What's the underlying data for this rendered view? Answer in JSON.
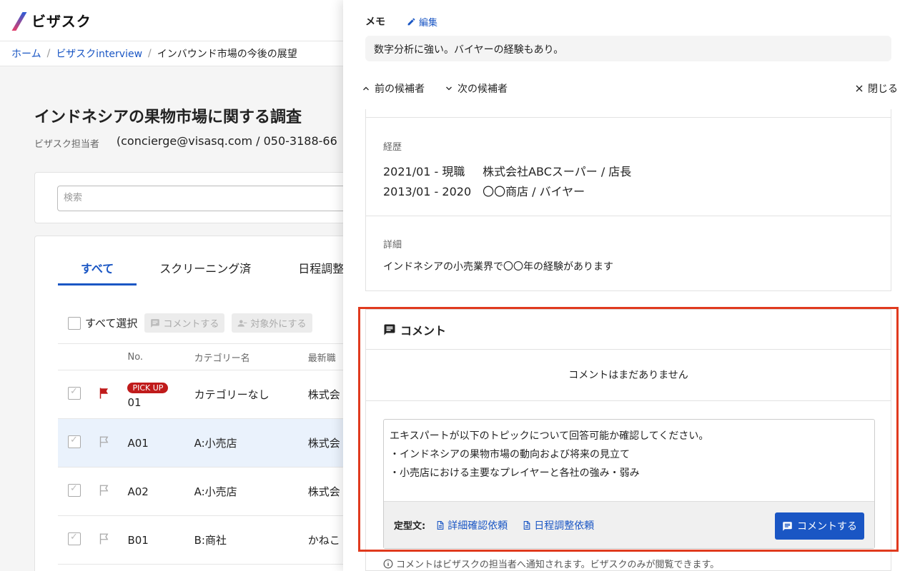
{
  "app": {
    "logo_text": "ビザスク"
  },
  "breadcrumb": {
    "home": "ホーム",
    "section": "ビザスクinterview",
    "current": "インバウンド市場の今後の展望",
    "sep": "/"
  },
  "project": {
    "title": "インドネシアの果物市場に関する調査",
    "owner_label": "ビザスク担当者",
    "owner_value": "(concierge@visasq.com / 050-3188-66"
  },
  "search": {
    "placeholder": "検索"
  },
  "tabs": [
    {
      "label": "すべて"
    },
    {
      "label": "スクリーニング済"
    },
    {
      "label": "日程調整"
    }
  ],
  "toolbar": {
    "select_all": "すべて選択",
    "comment": "コメントする",
    "exclude": "対象外にする"
  },
  "table": {
    "headers": {
      "no": "No.",
      "category": "カテゴリー名",
      "latest": "最新職"
    },
    "pick_badge": "PICK UP",
    "rows": [
      {
        "no": "01",
        "category": "カテゴリーなし",
        "company": "株式会"
      },
      {
        "no": "A01",
        "category": "A:小売店",
        "company": "株式会"
      },
      {
        "no": "A02",
        "category": "A:小売店",
        "company": "株式会"
      },
      {
        "no": "B01",
        "category": "B:商社",
        "company": "かねこ"
      }
    ]
  },
  "panel": {
    "memo_label": "メモ",
    "edit_label": "編集",
    "memo_text": "数字分析に強い。バイヤーの経験もあり。",
    "prev": "前の候補者",
    "next": "次の候補者",
    "close": "閉じる",
    "career_label": "経歴",
    "career": [
      {
        "period": "2021/01 - 現職",
        "desc": "株式会社ABCスーパー / 店長"
      },
      {
        "period": "2013/01 - 2020",
        "desc": "〇〇商店 / バイヤー"
      }
    ],
    "detail_label": "詳細",
    "detail_text": "インドネシアの小売業界で〇〇年の経験があります"
  },
  "comment": {
    "title": "コメント",
    "empty": "コメントはまだありません",
    "lines": [
      "エキスパートが以下のトピックについて回答可能か確認してください。",
      "・インドネシアの果物市場の動向および将来の見立て",
      "・小売店における主要なプレイヤーと各社の強み・弱み"
    ],
    "template_label": "定型文:",
    "tpl1": "詳細確認依頼",
    "tpl2": "日程調整依頼",
    "submit": "コメントする",
    "notice": "コメントはビザスクの担当者へ通知されます。ビザスクのみが閲覧できます。"
  },
  "colors": {
    "accent": "#1a56c4",
    "highlight_frame": "#e03a1e",
    "pick_badge": "#c01b1b"
  }
}
